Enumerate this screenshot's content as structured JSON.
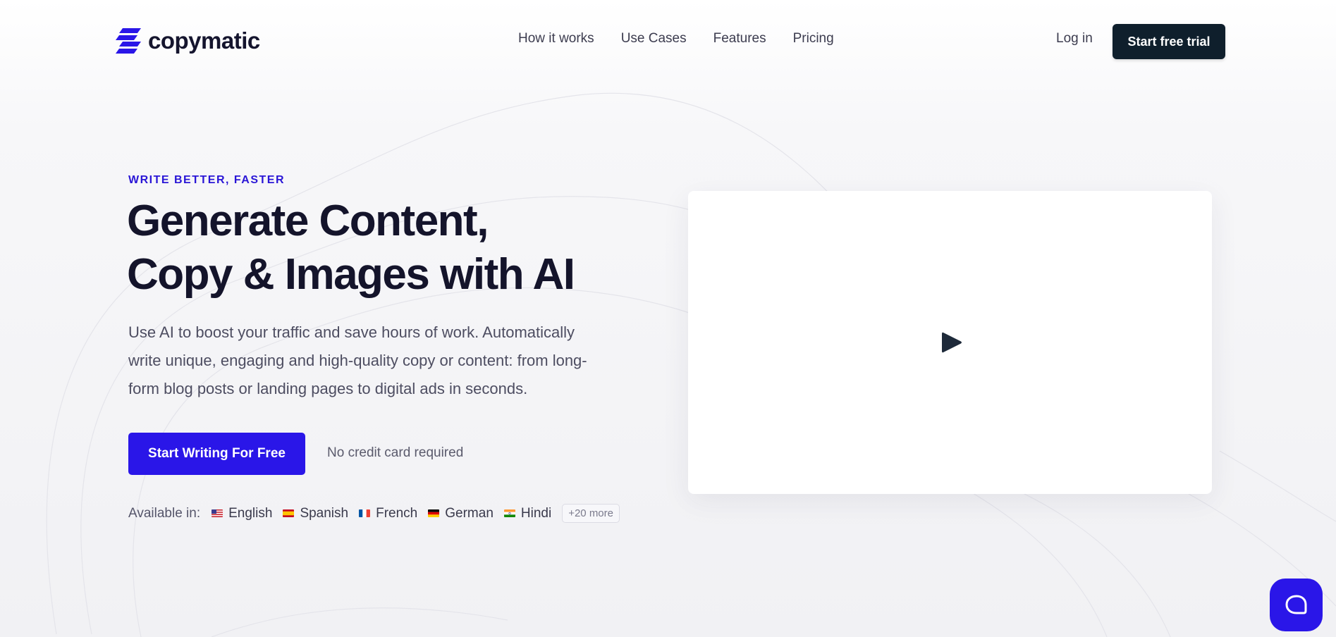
{
  "header": {
    "logo_text": "copymatic",
    "nav": [
      "How it works",
      "Use Cases",
      "Features",
      "Pricing"
    ],
    "login": "Log in",
    "trial_button": "Start free trial"
  },
  "hero": {
    "eyebrow": "WRITE BETTER, FASTER",
    "headline_line1": "Generate Content,",
    "headline_line2": "Copy & Images with AI",
    "description": "Use AI to boost your traffic and save hours of work. Automatically write unique, engaging and high-quality copy or content: from long-form blog posts or landing pages to digital ads in seconds.",
    "cta_button": "Start Writing For Free",
    "no_credit_card": "No credit card required",
    "available_label": "Available in:",
    "languages": [
      "English",
      "Spanish",
      "French",
      "German",
      "Hindi"
    ],
    "more_languages": "+20 more"
  },
  "colors": {
    "brand": "#2a16e8",
    "dark_button": "#0f1f2c",
    "text_dark": "#14142b"
  },
  "icons": {
    "logo": "copymatic-logo-icon",
    "video": "play-icon",
    "chat": "chat-bubble-icon"
  }
}
